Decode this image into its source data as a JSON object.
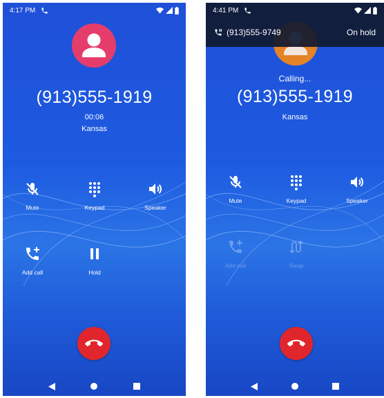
{
  "left": {
    "status": {
      "time": "4:17 PM"
    },
    "caller": {
      "number": "(913)555-1919",
      "timer": "00:06",
      "location": "Kansas"
    },
    "controls": {
      "mute": "Mute",
      "keypad": "Keypad",
      "speaker": "Speaker",
      "add_call": "Add call",
      "hold": "Hold"
    }
  },
  "right": {
    "status": {
      "time": "4:41 PM"
    },
    "held_call": {
      "number": "(913)555-9749",
      "status": "On hold"
    },
    "caller": {
      "state": "Calling...",
      "number": "(913)555-1919",
      "location": "Kansas"
    },
    "controls": {
      "mute": "Mute",
      "keypad": "Keypad",
      "speaker": "Speaker",
      "add_call": "Add call",
      "swap": "Swap"
    }
  },
  "colors": {
    "background_blue": "#1f50d8",
    "avatar_left": "#e53d6b",
    "avatar_right": "#f0861e",
    "end_call": "#e0262c",
    "held_banner": "#101a30"
  }
}
